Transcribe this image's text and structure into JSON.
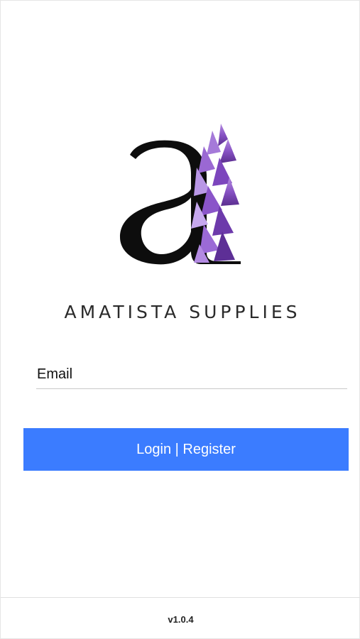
{
  "app": {
    "brand_name": "AMATISTA SUPPLIES",
    "logo_icon": "letter-a-amethyst-logo",
    "accent_color": "#3b7cff",
    "logo_purple": "#8b5cc7"
  },
  "form": {
    "email_placeholder": "Email",
    "email_value": "",
    "login_register_label": "Login | Register"
  },
  "footer": {
    "version": "v1.0.4"
  }
}
